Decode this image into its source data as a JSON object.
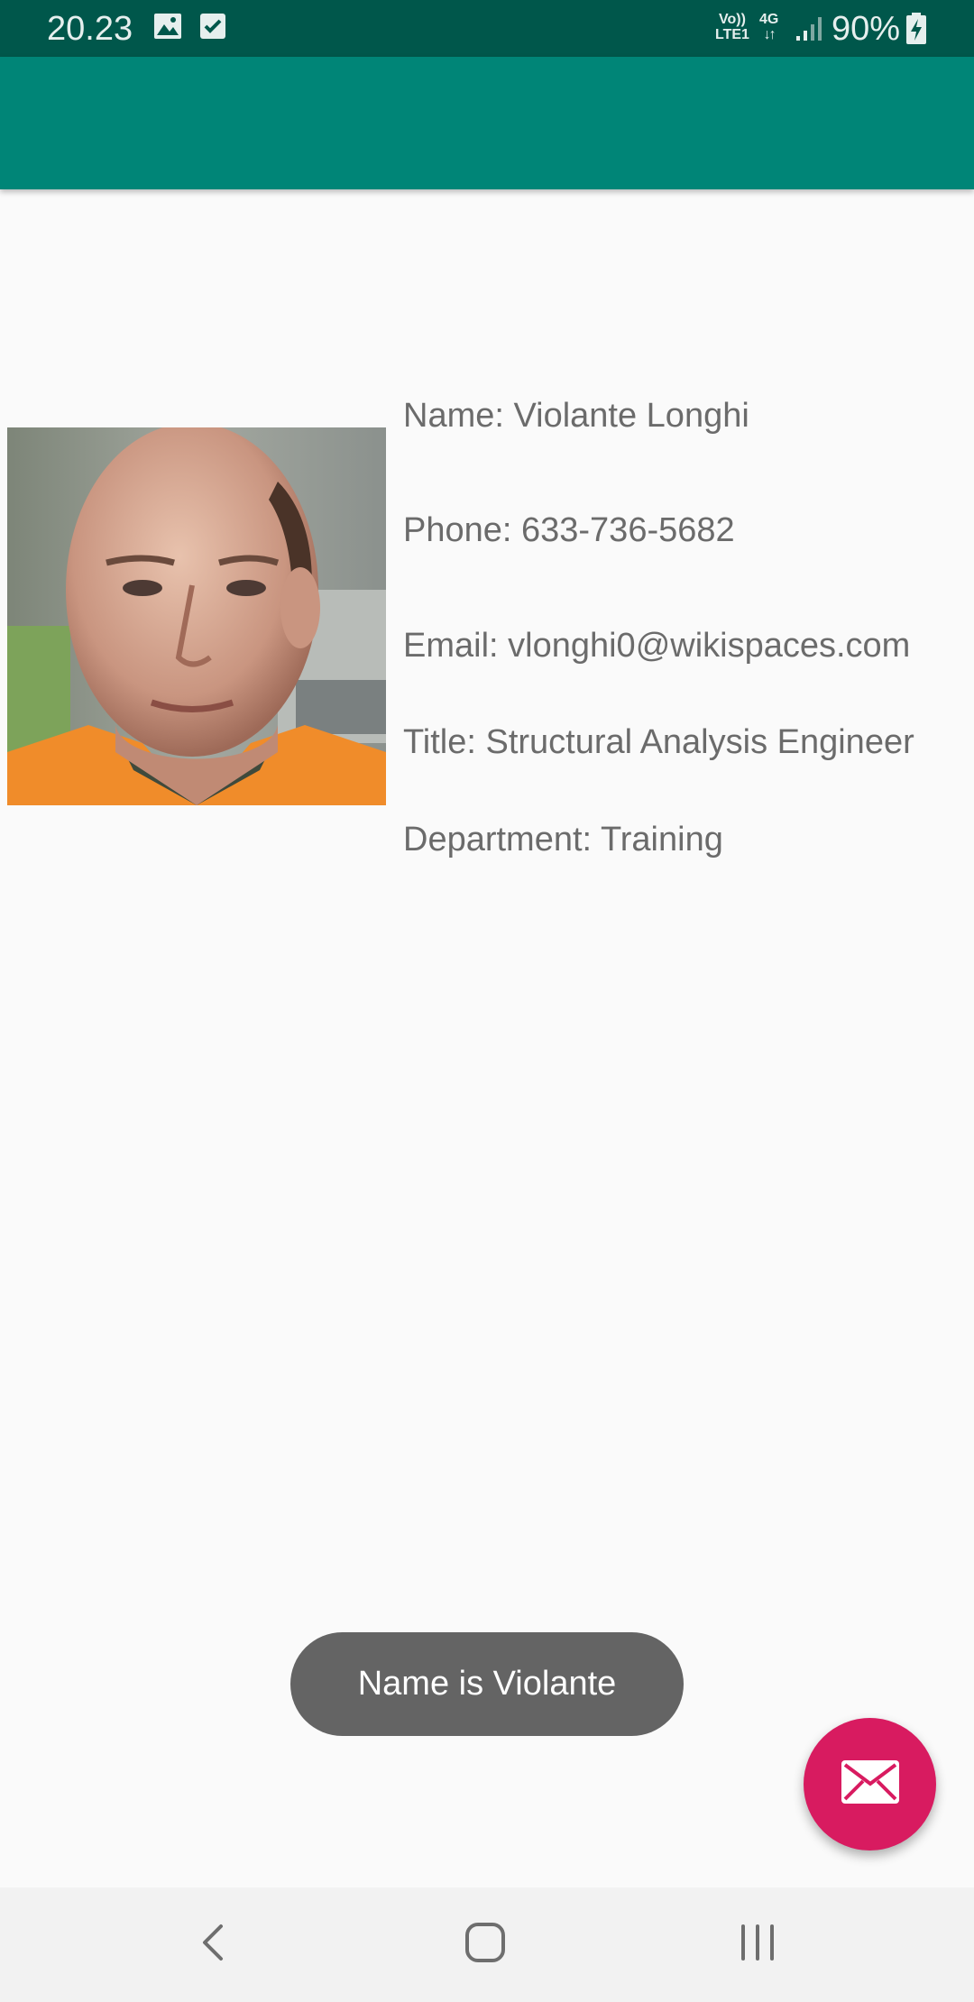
{
  "status_bar": {
    "time": "20.23",
    "network_top": "Vo))",
    "network_bottom": "LTE1",
    "network_type": "4G",
    "battery": "90%",
    "icons": [
      "image-icon",
      "check-box-icon",
      "volte-icon",
      "data-arrows-icon",
      "signal-icon",
      "battery-charging-icon"
    ]
  },
  "profile": {
    "photo_icon": "person-photo",
    "name": "Name: Violante Longhi",
    "phone": "Phone: 633-736-5682",
    "email": "Email: vlonghi0@wikispaces.com",
    "title": "Title: Structural Analysis Engineer",
    "department": "Department: Training"
  },
  "toast": {
    "message": "Name is Violante"
  },
  "fab": {
    "icon": "email-icon"
  },
  "nav_bar": {
    "icons": [
      "back-icon",
      "home-icon",
      "recents-icon"
    ]
  },
  "colors": {
    "status_bar": "#00574b",
    "app_bar": "#008577",
    "fab": "#d81b60",
    "toast": "#646464",
    "detail_text": "#6b6b6b"
  }
}
